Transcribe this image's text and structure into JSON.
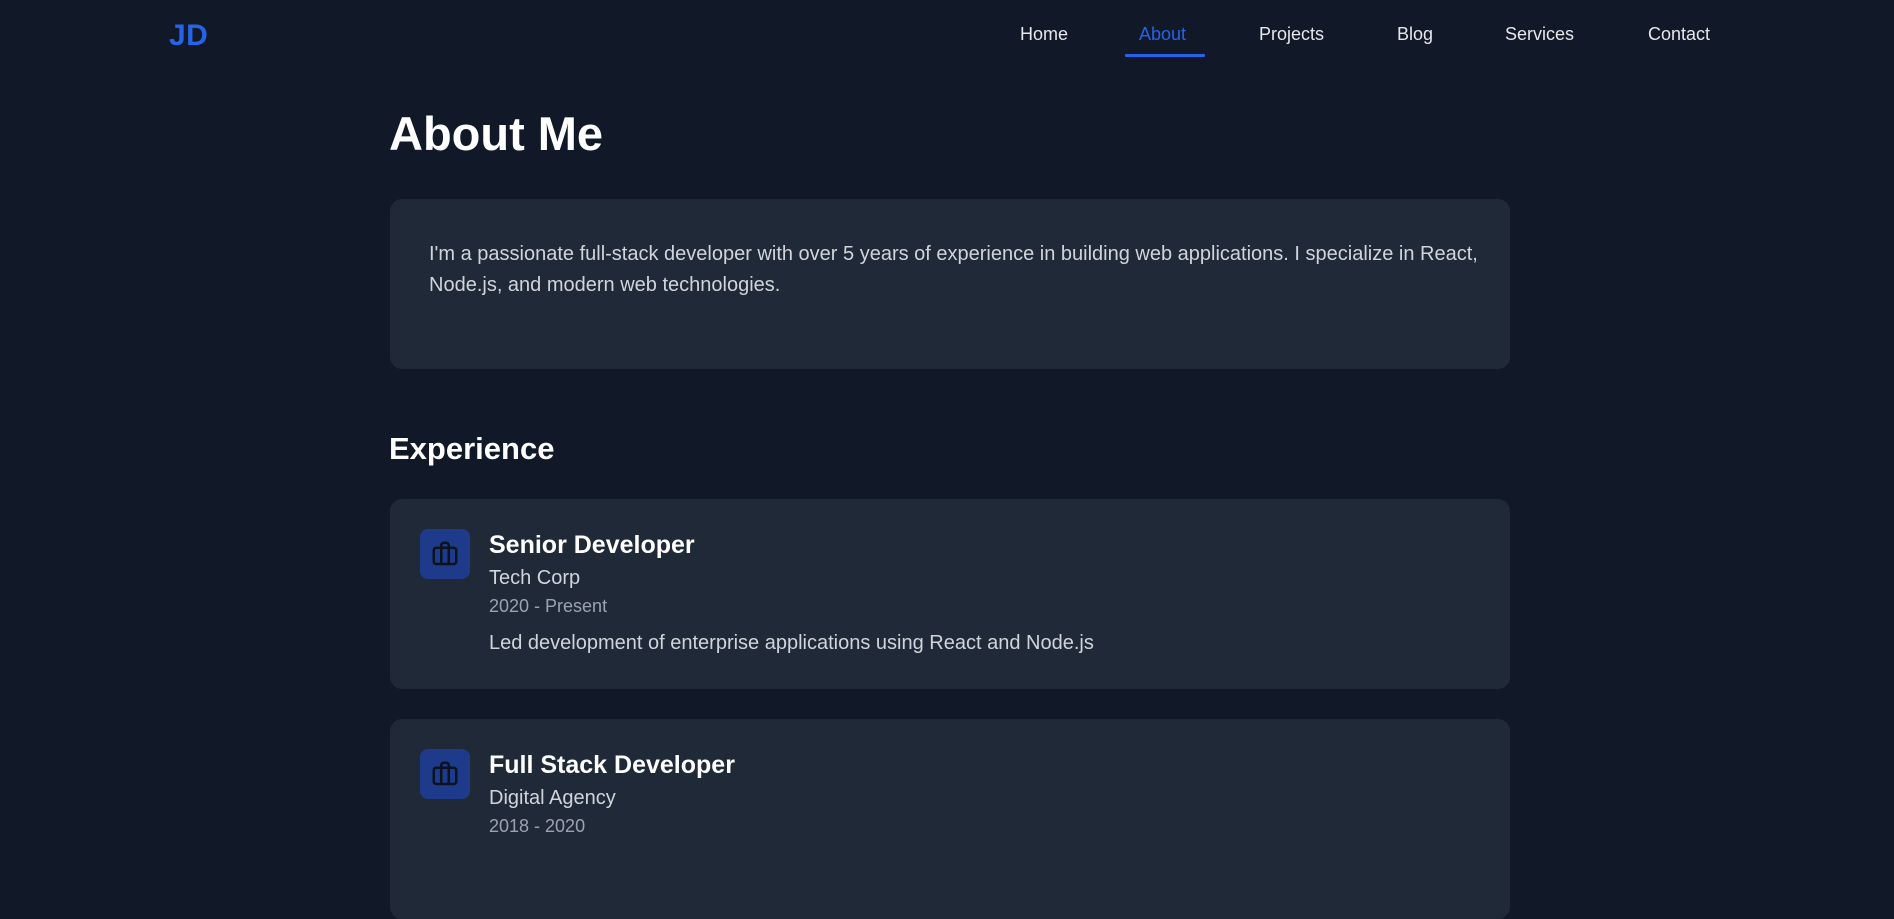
{
  "header": {
    "logo": "JD",
    "nav": [
      {
        "label": "Home",
        "active": false
      },
      {
        "label": "About",
        "active": true
      },
      {
        "label": "Projects",
        "active": false
      },
      {
        "label": "Blog",
        "active": false
      },
      {
        "label": "Services",
        "active": false
      },
      {
        "label": "Contact",
        "active": false
      }
    ]
  },
  "main": {
    "title": "About Me",
    "intro": "I'm a passionate full-stack developer with over 5 years of experience in building web applications. I specialize in React, Node.js, and modern web technologies.",
    "experience_title": "Experience",
    "experience": [
      {
        "icon": "briefcase-icon",
        "title": "Senior Developer",
        "company": "Tech Corp",
        "period": "2020 - Present",
        "description": "Led development of enterprise applications using React and Node.js"
      },
      {
        "icon": "briefcase-icon",
        "title": "Full Stack Developer",
        "company": "Digital Agency",
        "period": "2018 - 2020",
        "description": ""
      }
    ]
  },
  "colors": {
    "background": "#111827",
    "card": "#1f2937",
    "accent": "#2563eb",
    "icon_bg": "#1e3a8a"
  }
}
